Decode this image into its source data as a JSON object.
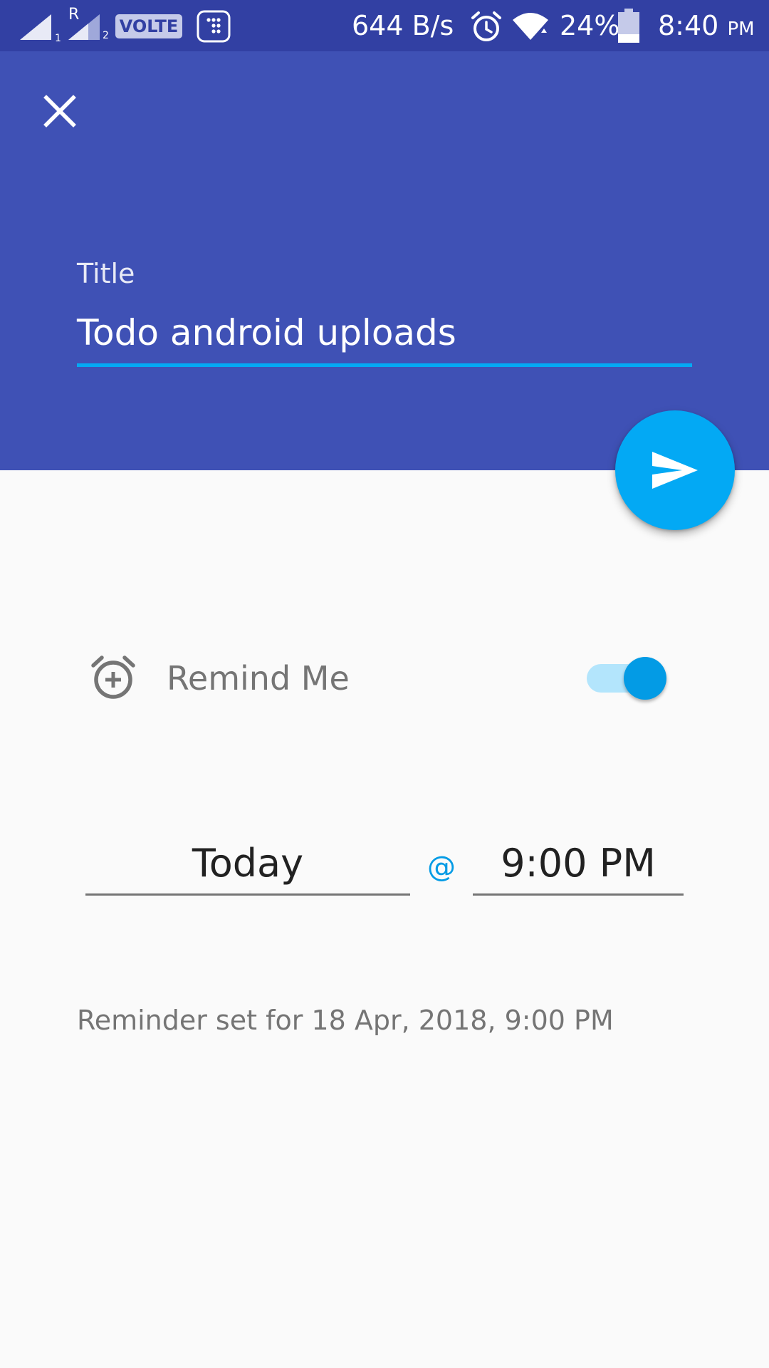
{
  "status_bar": {
    "sim1_label": "1",
    "sim2_roaming": "R",
    "sim2_label": "2",
    "volte": "VOLTE",
    "net_speed": "644 B/s",
    "battery": "24%",
    "time": "8:40",
    "time_suffix": "PM",
    "icons": [
      "signal-sim1-icon",
      "signal-sim2-icon",
      "volte-icon",
      "app-notification-icon",
      "alarm-status-icon",
      "wifi-icon",
      "battery-icon"
    ]
  },
  "header": {
    "close_icon": "close-icon",
    "title_label": "Title",
    "title_value": "Todo android uploads",
    "accent_color": "#03A9F4",
    "background_color": "#3F51B5"
  },
  "fab": {
    "icon": "send-icon"
  },
  "remind": {
    "icon": "add-alarm-icon",
    "label": "Remind Me",
    "enabled": true
  },
  "schedule": {
    "date_value": "Today",
    "separator": "@",
    "time_value": "9:00 PM"
  },
  "summary": {
    "text": "Reminder set for 18 Apr, 2018, 9:00 PM"
  }
}
